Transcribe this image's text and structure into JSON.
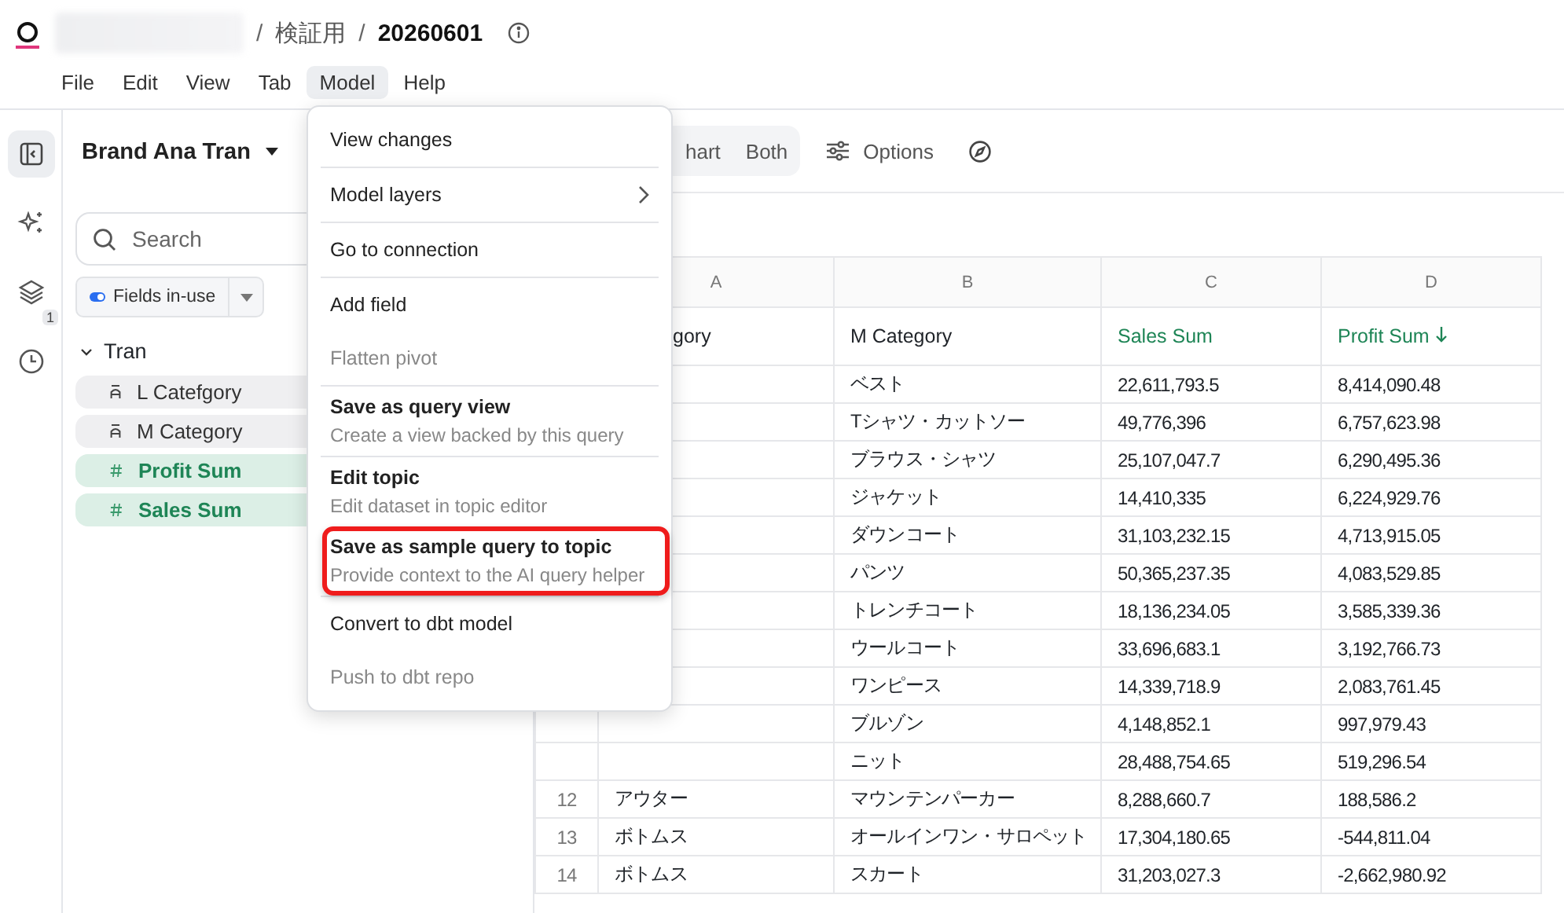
{
  "breadcrumb": [
    {
      "kind": "redacted"
    },
    {
      "kind": "separator",
      "text": "/"
    },
    {
      "kind": "crumb",
      "text": "検証用",
      "current": false
    },
    {
      "kind": "separator",
      "text": "/"
    },
    {
      "kind": "crumb",
      "text": "20260601",
      "current": true
    }
  ],
  "menubar": [
    {
      "label": "File",
      "selected": false
    },
    {
      "label": "Edit",
      "selected": false
    },
    {
      "label": "View",
      "selected": false
    },
    {
      "label": "Tab",
      "selected": false
    },
    {
      "label": "Model",
      "selected": true
    },
    {
      "label": "Help",
      "selected": false
    }
  ],
  "rail": [
    {
      "kind": "panel",
      "selected": true
    },
    {
      "kind": "sparkle",
      "selected": false
    },
    {
      "kind": "layers",
      "selected": false,
      "badge": "1"
    },
    {
      "kind": "history",
      "selected": false
    }
  ],
  "sidebar": {
    "title": "Brand Ana Tran",
    "search": {
      "placeholder": "Search"
    },
    "filter": {
      "label": "Fields in-use",
      "on": true
    },
    "groups": [
      {
        "label": "Tran",
        "expanded": true,
        "fields": [
          {
            "label": "L Catefgory",
            "kind": "dimension"
          },
          {
            "label": "M Category",
            "kind": "dimension"
          },
          {
            "label": "Profit Sum",
            "kind": "measure"
          },
          {
            "label": "Sales Sum",
            "kind": "measure"
          }
        ]
      }
    ]
  },
  "toolbar": {
    "views": [
      {
        "label": "hart",
        "selected": false
      },
      {
        "label": "Both",
        "selected": false
      }
    ],
    "options": "Options"
  },
  "table": {
    "columns": [
      {
        "letter": "A",
        "field": "gory",
        "kind": "dimension",
        "sorted_descending": false
      },
      {
        "letter": "B",
        "field": "M Category",
        "kind": "dimension",
        "sorted_descending": false
      },
      {
        "letter": "C",
        "field": "Sales Sum",
        "kind": "measure",
        "sorted_descending": false
      },
      {
        "letter": "D",
        "field": "Profit Sum",
        "kind": "measure",
        "sorted_descending": true
      }
    ],
    "rows": [
      {
        "cells": [
          "",
          "ベスト",
          "22,611,793.5",
          "8,414,090.48"
        ]
      },
      {
        "cells": [
          "",
          "Tシャツ・カットソー",
          "49,776,396",
          "6,757,623.98"
        ]
      },
      {
        "cells": [
          "",
          "ブラウス・シャツ",
          "25,107,047.7",
          "6,290,495.36"
        ]
      },
      {
        "cells": [
          "",
          "ジャケット",
          "14,410,335",
          "6,224,929.76"
        ]
      },
      {
        "cells": [
          "",
          "ダウンコート",
          "31,103,232.15",
          "4,713,915.05"
        ]
      },
      {
        "cells": [
          "",
          "パンツ",
          "50,365,237.35",
          "4,083,529.85"
        ]
      },
      {
        "cells": [
          "",
          "トレンチコート",
          "18,136,234.05",
          "3,585,339.36"
        ]
      },
      {
        "cells": [
          "",
          "ウールコート",
          "33,696,683.1",
          "3,192,766.73"
        ]
      },
      {
        "cells": [
          "",
          "ワンピース",
          "14,339,718.9",
          "2,083,761.45"
        ]
      },
      {
        "cells": [
          "",
          "ブルゾン",
          "4,148,852.1",
          "997,979.43"
        ]
      },
      {
        "cells": [
          "",
          "ニット",
          "28,488,754.65",
          "519,296.54"
        ]
      },
      {
        "number": "12",
        "cells": [
          "アウター",
          "マウンテンパーカー",
          "8,288,660.7",
          "188,586.2"
        ]
      },
      {
        "number": "13",
        "cells": [
          "ボトムス",
          "オールインワン・サロペット",
          "17,304,180.65",
          "-544,811.04"
        ]
      },
      {
        "number": "14",
        "cells": [
          "ボトムス",
          "スカート",
          "31,203,027.3",
          "-2,662,980.92"
        ]
      }
    ]
  },
  "menu": {
    "groups": [
      [
        {
          "kind": "plain",
          "label": "View changes",
          "disabled": false,
          "highlighted": false
        }
      ],
      [
        {
          "kind": "submenu",
          "label": "Model layers",
          "disabled": false,
          "highlighted": false
        }
      ],
      [
        {
          "kind": "plain",
          "label": "Go to connection",
          "disabled": false,
          "highlighted": false
        }
      ],
      [
        {
          "kind": "plain",
          "label": "Add field",
          "disabled": false,
          "highlighted": false
        },
        {
          "kind": "plain",
          "label": "Flatten pivot",
          "disabled": true,
          "highlighted": false
        }
      ],
      [
        {
          "kind": "described",
          "label": "Save as query view",
          "description": "Create a view backed by this query",
          "disabled": false,
          "highlighted": false
        }
      ],
      [
        {
          "kind": "described",
          "label": "Edit topic",
          "description": "Edit dataset in topic editor",
          "disabled": false,
          "highlighted": false
        },
        {
          "kind": "described",
          "label": "Save as sample query to topic",
          "description": "Provide context to the AI query helper",
          "disabled": false,
          "highlighted": true
        }
      ],
      [
        {
          "kind": "plain",
          "label": "Convert to dbt model",
          "disabled": false,
          "highlighted": false
        },
        {
          "kind": "plain",
          "label": "Push to dbt repo",
          "disabled": true,
          "highlighted": false
        }
      ]
    ]
  }
}
